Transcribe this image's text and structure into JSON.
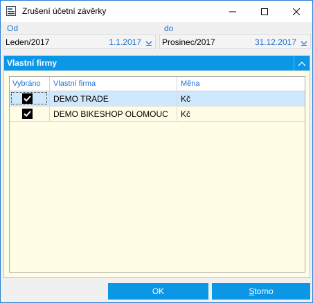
{
  "window": {
    "title": "Zrušení účetní závěrky",
    "controls": [
      "minimize",
      "maximize",
      "close"
    ]
  },
  "period": {
    "from_label": "Od",
    "from_value": "Leden/2017",
    "from_date": "1.1.2017",
    "to_label": "do",
    "to_value": "Prosinec/2017",
    "to_date": "31.12.2017"
  },
  "companies": {
    "section_title": "Vlastní firmy",
    "columns": [
      "Vybráno",
      "Vlastní firma",
      "Měna"
    ],
    "rows": [
      {
        "selected": true,
        "name": "DEMO TRADE",
        "currency": "Kč"
      },
      {
        "selected": true,
        "name": "DEMO BIKESHOP OLOMOUC",
        "currency": "Kč"
      }
    ]
  },
  "buttons": {
    "ok": "OK",
    "cancel_first": "S",
    "cancel_rest": "torno"
  },
  "colors": {
    "accent": "#0c96e6",
    "label_blue": "#1f6fd0",
    "selected_row": "#cfe8fb",
    "grid_bg": "#fffde6"
  }
}
